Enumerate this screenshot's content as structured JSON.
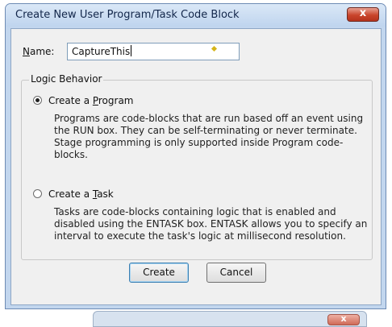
{
  "window": {
    "title": "Create New User Program/Task Code Block",
    "close_glyph": "x"
  },
  "form": {
    "name_label_hotkey": "N",
    "name_label_rest": "ame:",
    "name_value": "CaptureThis"
  },
  "logic_behavior": {
    "legend": "Logic Behavior",
    "options": [
      {
        "label_prefix": "Create a ",
        "label_hotkey": "P",
        "label_rest": "rogram",
        "selected": true,
        "description": "Programs are code-blocks that are run based off an event using the RUN box. They can be self-terminating or never terminate.  Stage programming is only supported inside Program code-blocks."
      },
      {
        "label_prefix": "Create a ",
        "label_hotkey": "T",
        "label_rest": "ask",
        "selected": false,
        "description": "Tasks are code-blocks containing logic that is enabled and disabled using the ENTASK box. ENTASK allows you to specify an interval to execute the task's logic at millisecond resolution."
      }
    ]
  },
  "buttons": {
    "create": "Create",
    "cancel": "Cancel"
  },
  "background_window": {
    "close_glyph": "x"
  }
}
